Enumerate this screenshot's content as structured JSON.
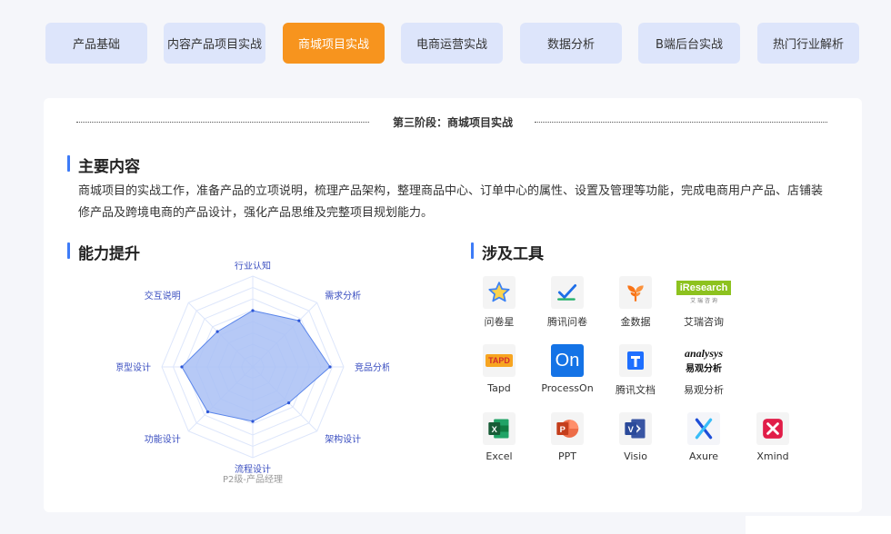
{
  "tabs": [
    {
      "label": "产品基础",
      "active": false
    },
    {
      "label": "内容产品项目实战",
      "active": false
    },
    {
      "label": "商城项目实战",
      "active": true
    },
    {
      "label": "电商运营实战",
      "active": false
    },
    {
      "label": "数据分析",
      "active": false
    },
    {
      "label": "B端后台实战",
      "active": false
    },
    {
      "label": "热门行业解析",
      "active": false
    }
  ],
  "stage_title": "第三阶段：商城项目实战",
  "main_content": {
    "heading": "主要内容",
    "text": "商城项目的实战工作，准备产品的立项说明，梳理产品架构，整理商品中心、订单中心的属性、设置及管理等功能，完成电商用户产品、店铺装修产品及跨境电商的产品设计，强化产品思维及完整项目规划能力。"
  },
  "ability": {
    "heading": "能力提升",
    "caption": "P2级-产品经理",
    "axes": [
      "行业认知",
      "需求分析",
      "竞品分析",
      "架构设计",
      "流程设计",
      "功能设计",
      "原型设计",
      "交互说明"
    ],
    "values": [
      0.62,
      0.72,
      0.85,
      0.56,
      0.6,
      0.7,
      0.78,
      0.55
    ],
    "max": 1,
    "colors": {
      "fill": "#a9bff5",
      "stroke": "#5b86ea",
      "point": "#2c55d6",
      "grid": "#dde6fb"
    }
  },
  "tools": {
    "heading": "涉及工具",
    "items": [
      {
        "name": "问卷星",
        "icon": "star-icon"
      },
      {
        "name": "腾讯问卷",
        "icon": "check-icon"
      },
      {
        "name": "金数据",
        "icon": "leaf-icon"
      },
      {
        "name": "艾瑞咨询",
        "icon": "iresearch-logo",
        "logo_text": "iResearch",
        "logo_sub": "艾 瑞 咨 询"
      },
      {
        "name": "Tapd",
        "icon": "tapd-logo",
        "logo_text": "TAPD"
      },
      {
        "name": "ProcessOn",
        "icon": "processon-logo",
        "logo_text": "On"
      },
      {
        "name": "腾讯文档",
        "icon": "tencent-docs-icon"
      },
      {
        "name": "易观分析",
        "icon": "analysys-logo",
        "logo_text": "analysys",
        "logo_sub": "易观分析"
      },
      {
        "name": "Excel",
        "icon": "excel-icon",
        "logo_text": "X"
      },
      {
        "name": "PPT",
        "icon": "ppt-icon",
        "logo_text": "P"
      },
      {
        "name": "Visio",
        "icon": "visio-icon",
        "logo_text": "V"
      },
      {
        "name": "Axure",
        "icon": "axure-icon",
        "logo_text": "X"
      },
      {
        "name": "Xmind",
        "icon": "xmind-icon"
      }
    ]
  },
  "colors": {
    "accent": "#f7941e",
    "tab_bg": "#dde5fb",
    "heading_bar": "#3d7bf7"
  }
}
